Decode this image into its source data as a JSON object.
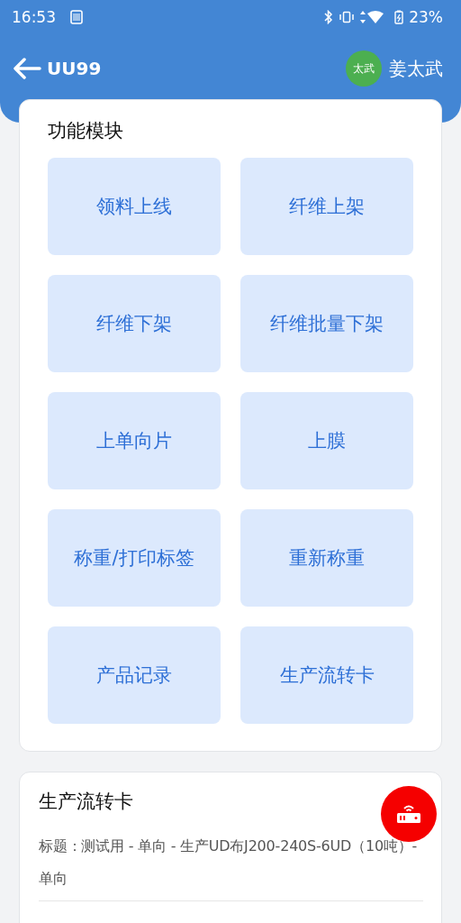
{
  "status_bar": {
    "time": "16:53",
    "battery": "23%"
  },
  "header": {
    "title": "UU99",
    "avatar": "太武",
    "user": "姜太武"
  },
  "modules": {
    "title": "功能模块",
    "items": [
      {
        "label": "领料上线"
      },
      {
        "label": "纤维上架"
      },
      {
        "label": "纤维下架"
      },
      {
        "label": "纤维批量下架"
      },
      {
        "label": "上单向片"
      },
      {
        "label": "上膜"
      },
      {
        "label": "称重/打印标签"
      },
      {
        "label": "重新称重"
      },
      {
        "label": "产品记录"
      },
      {
        "label": "生产流转卡"
      }
    ]
  },
  "card": {
    "title": "生产流转卡",
    "lines": [
      "标题：测试用 - 单向 - 生产UD布J200-240S-6UD（10吨）- 单向"
    ]
  }
}
